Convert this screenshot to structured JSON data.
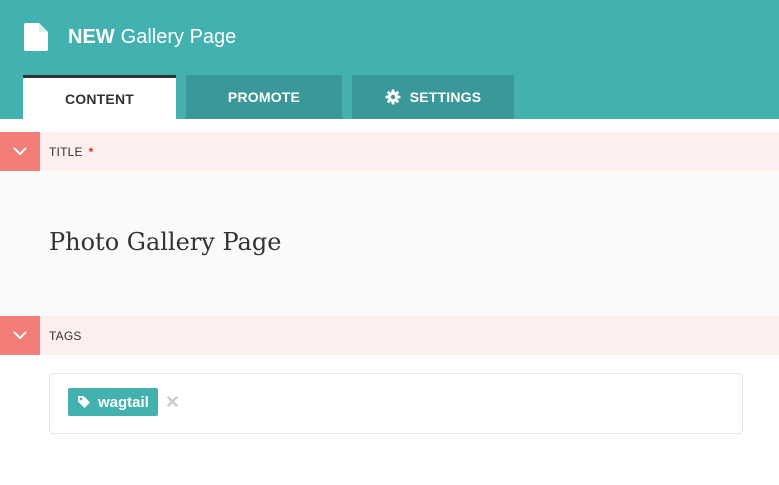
{
  "header": {
    "new_label": "NEW",
    "page_type": "Gallery Page",
    "icon": "document-icon"
  },
  "tabs": [
    {
      "label": "CONTENT",
      "active": true
    },
    {
      "label": "PROMOTE",
      "active": false
    },
    {
      "label": "SETTINGS",
      "active": false,
      "icon": "gear-icon"
    }
  ],
  "fields": {
    "title": {
      "label": "TITLE",
      "required_marker": "*",
      "value": "Photo Gallery Page"
    },
    "tags": {
      "label": "TAGS",
      "items": [
        "wagtail"
      ]
    }
  },
  "colors": {
    "header_teal": "#43b1b0",
    "tab_dark_teal": "#3a9998",
    "field_header_bg": "#fcefed",
    "toggle_salmon": "#f37e77",
    "required_red": "#cd3238"
  }
}
